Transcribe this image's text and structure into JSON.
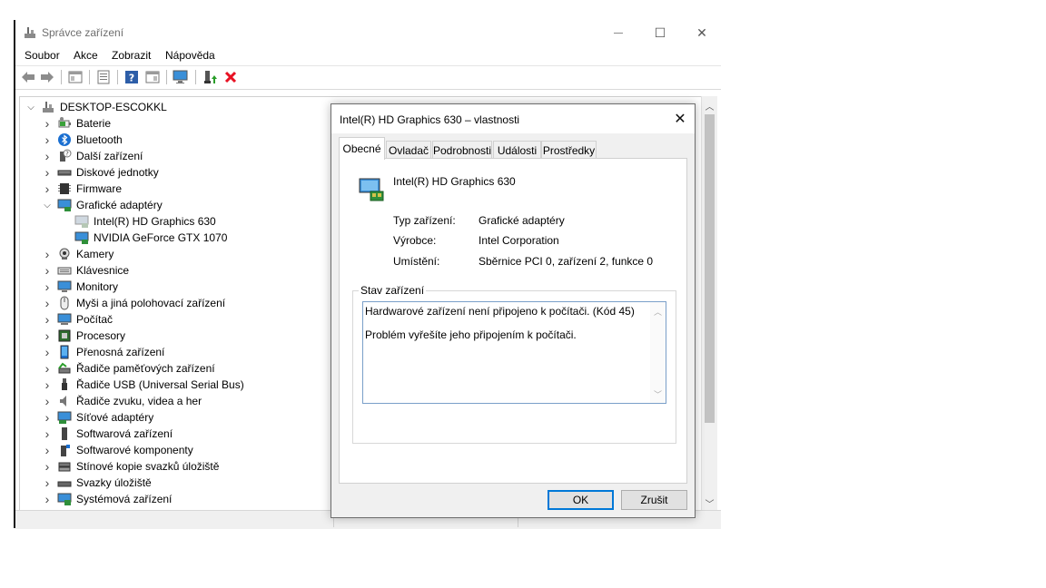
{
  "window": {
    "title": "Správce zařízení",
    "minimize": "—",
    "maximize": "☐",
    "close": "✕"
  },
  "menu": [
    "Soubor",
    "Akce",
    "Zobrazit",
    "Nápověda"
  ],
  "tree": {
    "root": "DESKTOP-ESCOKKL",
    "items": [
      {
        "label": "Baterie",
        "icon": "battery-icon",
        "expanded": false
      },
      {
        "label": "Bluetooth",
        "icon": "bluetooth-icon",
        "expanded": false
      },
      {
        "label": "Další zařízení",
        "icon": "unknown-device-icon",
        "expanded": false
      },
      {
        "label": "Diskové jednotky",
        "icon": "disk-drive-icon",
        "expanded": false
      },
      {
        "label": "Firmware",
        "icon": "firmware-icon",
        "expanded": false
      },
      {
        "label": "Grafické adaptéry",
        "icon": "display-adapter-icon",
        "expanded": true,
        "children": [
          {
            "label": "Intel(R) HD Graphics 630",
            "icon": "display-adapter-disabled-icon"
          },
          {
            "label": "NVIDIA GeForce GTX 1070",
            "icon": "display-adapter-icon"
          }
        ]
      },
      {
        "label": "Kamery",
        "icon": "camera-icon",
        "expanded": false
      },
      {
        "label": "Klávesnice",
        "icon": "keyboard-icon",
        "expanded": false
      },
      {
        "label": "Monitory",
        "icon": "monitor-icon",
        "expanded": false
      },
      {
        "label": "Myši a jiná polohovací zařízení",
        "icon": "mouse-icon",
        "expanded": false
      },
      {
        "label": "Počítač",
        "icon": "computer-icon",
        "expanded": false
      },
      {
        "label": "Procesory",
        "icon": "processor-icon",
        "expanded": false
      },
      {
        "label": "Přenosná zařízení",
        "icon": "portable-device-icon",
        "expanded": false
      },
      {
        "label": "Řadiče paměťových zařízení",
        "icon": "storage-controller-icon",
        "expanded": false
      },
      {
        "label": "Řadiče USB (Universal Serial Bus)",
        "icon": "usb-icon",
        "expanded": false
      },
      {
        "label": "Řadiče zvuku, videa a her",
        "icon": "speaker-icon",
        "expanded": false
      },
      {
        "label": "Síťové adaptéry",
        "icon": "network-adapter-icon",
        "expanded": false
      },
      {
        "label": "Softwarová zařízení",
        "icon": "software-device-icon",
        "expanded": false
      },
      {
        "label": "Softwarové komponenty",
        "icon": "software-component-icon",
        "expanded": false
      },
      {
        "label": "Stínové kopie svazků úložiště",
        "icon": "shadow-copy-icon",
        "expanded": false
      },
      {
        "label": "Svazky úložiště",
        "icon": "storage-volume-icon",
        "expanded": false
      },
      {
        "label": "Systémová zařízení",
        "icon": "system-device-icon",
        "expanded": false
      }
    ]
  },
  "dialog": {
    "title": "Intel(R) HD Graphics 630 – vlastnosti",
    "close": "✕",
    "tabs": [
      "Obecné",
      "Ovladač",
      "Podrobnosti",
      "Události",
      "Prostředky"
    ],
    "active_tab": 0,
    "device_name": "Intel(R) HD Graphics 630",
    "props": [
      {
        "label": "Typ zařízení:",
        "value": "Grafické adaptéry"
      },
      {
        "label": "Výrobce:",
        "value": "Intel Corporation"
      },
      {
        "label": "Umístění:",
        "value": "Sběrnice PCI 0, zařízení 2, funkce 0"
      }
    ],
    "status_group": "Stav zařízení",
    "status_lines": [
      "Hardwarové zařízení není připojeno k počítači. (Kód 45)",
      "Problém vyřešíte jeho připojením k počítači."
    ],
    "ok": "OK",
    "cancel": "Zrušit"
  },
  "colors": {
    "accent": "#0078d7",
    "error_red": "#e81123",
    "help_blue": "#2d5ea8"
  }
}
